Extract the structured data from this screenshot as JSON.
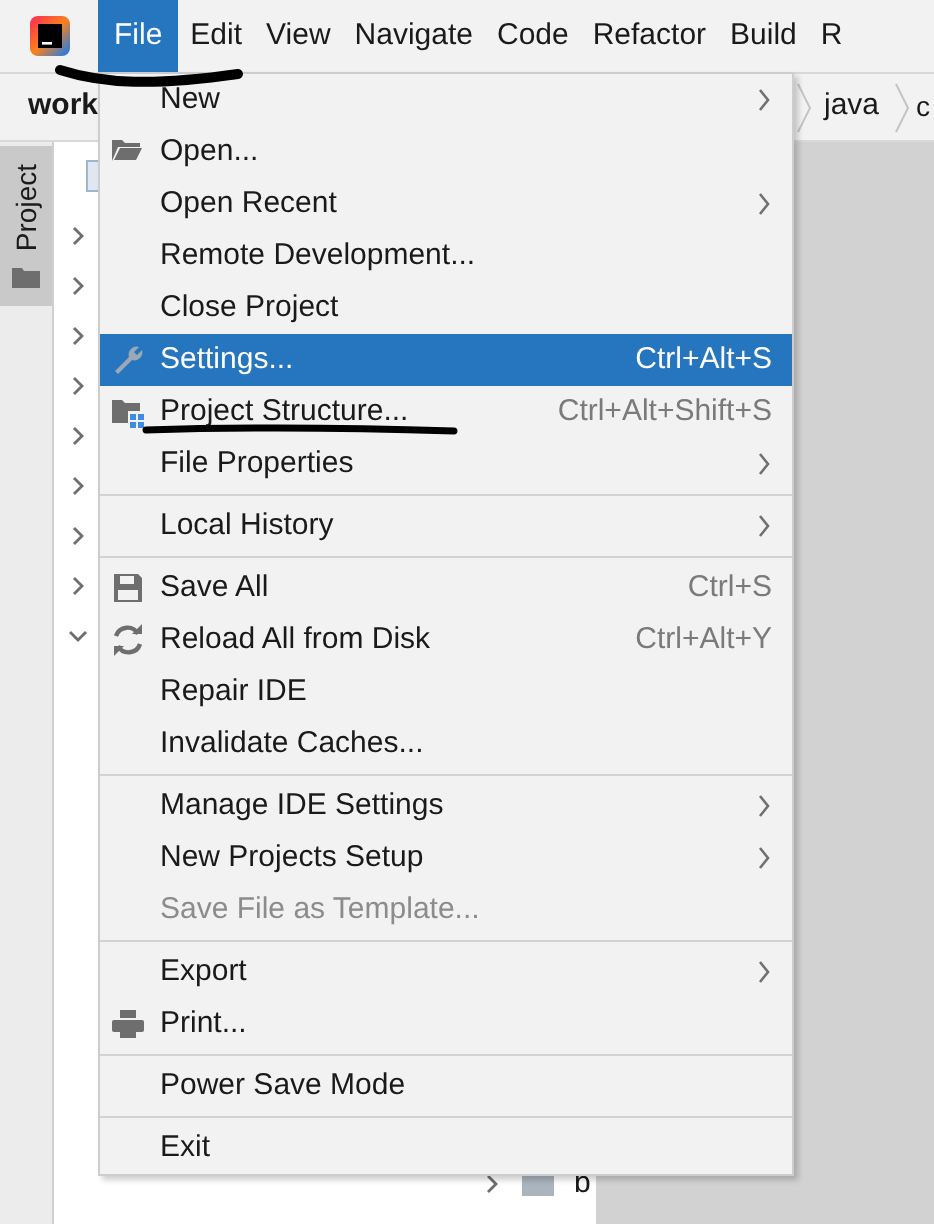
{
  "menu_bar": {
    "items": [
      {
        "label": "File",
        "selected": true
      },
      {
        "label": "Edit",
        "selected": false
      },
      {
        "label": "View",
        "selected": false
      },
      {
        "label": "Navigate",
        "selected": false
      },
      {
        "label": "Code",
        "selected": false
      },
      {
        "label": "Refactor",
        "selected": false
      },
      {
        "label": "Build",
        "selected": false
      },
      {
        "label": "R",
        "selected": false
      }
    ]
  },
  "breadcrumb": [
    "work",
    "java",
    "c"
  ],
  "side_tab": {
    "label": "Project"
  },
  "tree": {
    "rows": [
      {
        "expanded": false
      },
      {
        "expanded": false
      },
      {
        "expanded": false
      },
      {
        "expanded": false
      },
      {
        "expanded": false
      },
      {
        "expanded": false
      },
      {
        "expanded": false
      },
      {
        "expanded": false
      },
      {
        "expanded": true
      }
    ],
    "bottom_row": {
      "label": "b",
      "expanded": false
    }
  },
  "file_menu": {
    "sections": [
      {
        "items": [
          {
            "label": "New",
            "submenu": true,
            "selected": false,
            "disabled": false
          },
          {
            "label": "Open...",
            "submenu": false,
            "selected": false,
            "disabled": false
          },
          {
            "label": "Open Recent",
            "submenu": true,
            "selected": false,
            "disabled": false
          },
          {
            "label": "Remote Development...",
            "submenu": false,
            "selected": false,
            "disabled": false
          },
          {
            "label": "Close Project",
            "submenu": false,
            "selected": false,
            "disabled": false
          },
          {
            "label": "Settings...",
            "shortcut": "Ctrl+Alt+S",
            "submenu": false,
            "selected": true,
            "disabled": false
          },
          {
            "label": "Project Structure...",
            "shortcut": "Ctrl+Alt+Shift+S",
            "submenu": false,
            "selected": false,
            "disabled": false
          },
          {
            "label": "File Properties",
            "submenu": true,
            "selected": false,
            "disabled": false
          }
        ]
      },
      {
        "items": [
          {
            "label": "Local History",
            "submenu": true,
            "selected": false,
            "disabled": false
          }
        ]
      },
      {
        "items": [
          {
            "label": "Save All",
            "shortcut": "Ctrl+S",
            "submenu": false,
            "selected": false,
            "disabled": false
          },
          {
            "label": "Reload All from Disk",
            "shortcut": "Ctrl+Alt+Y",
            "submenu": false,
            "selected": false,
            "disabled": false
          },
          {
            "label": "Repair IDE",
            "submenu": false,
            "selected": false,
            "disabled": false
          },
          {
            "label": "Invalidate Caches...",
            "submenu": false,
            "selected": false,
            "disabled": false
          }
        ]
      },
      {
        "items": [
          {
            "label": "Manage IDE Settings",
            "submenu": true,
            "selected": false,
            "disabled": false
          },
          {
            "label": "New Projects Setup",
            "submenu": true,
            "selected": false,
            "disabled": false
          },
          {
            "label": "Save File as Template...",
            "submenu": false,
            "selected": false,
            "disabled": true
          }
        ]
      },
      {
        "items": [
          {
            "label": "Export",
            "submenu": true,
            "selected": false,
            "disabled": false
          },
          {
            "label": "Print...",
            "submenu": false,
            "selected": false,
            "disabled": false
          }
        ]
      },
      {
        "items": [
          {
            "label": "Power Save Mode",
            "submenu": false,
            "selected": false,
            "disabled": false
          }
        ]
      },
      {
        "items": [
          {
            "label": "Exit",
            "submenu": false,
            "selected": false,
            "disabled": false
          }
        ]
      }
    ]
  }
}
